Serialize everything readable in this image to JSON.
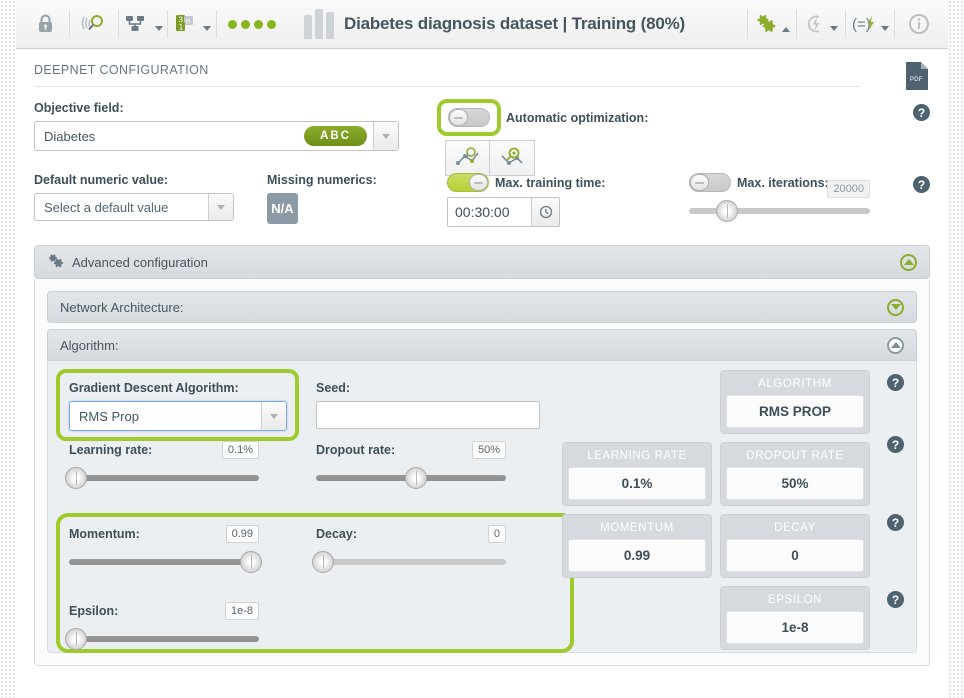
{
  "header": {
    "title": "Diabetes diagnosis dataset | Training (80%)",
    "icons": {
      "lock": "lock-icon",
      "source": "source-search-icon",
      "dataset": "dataset-tree-icon",
      "model": "model-badge-icon",
      "gear": "gear-icon",
      "flash": "flash-icon",
      "script": "script-icon",
      "info": "info-icon"
    }
  },
  "page": {
    "section_title": "DEEPNET CONFIGURATION",
    "pdf_label": "PDF"
  },
  "objective": {
    "label": "Objective field:",
    "value": "Diabetes",
    "badge": "ABC"
  },
  "automatic_optimization": {
    "label": "Automatic optimization:",
    "toggle_state": "off",
    "buttons": [
      "optimize-network-icon",
      "search-network-icon"
    ]
  },
  "default_numeric": {
    "label": "Default numeric value:",
    "placeholder": "Select a default value"
  },
  "missing_numerics": {
    "label": "Missing numerics:",
    "value": "N/A"
  },
  "max_training_time": {
    "label": "Max. training time:",
    "toggle_state": "on",
    "value": "00:30:00"
  },
  "max_iterations": {
    "label": "Max. iterations:",
    "toggle_state": "off",
    "value": "20000",
    "slider_percent": 20
  },
  "advanced": {
    "label": "Advanced configuration",
    "network_architecture": "Network Architecture:",
    "algorithm": "Algorithm:"
  },
  "algorithm_form": {
    "gradient_label": "Gradient Descent Algorithm:",
    "gradient_value": "RMS Prop",
    "seed_label": "Seed:",
    "seed_value": "",
    "learning_rate_label": "Learning rate:",
    "learning_rate_value": "0.1%",
    "learning_rate_percent": 2,
    "dropout_label": "Dropout rate:",
    "dropout_value": "50%",
    "dropout_percent": 50,
    "momentum_label": "Momentum:",
    "momentum_value": "0.99",
    "momentum_percent": 92,
    "decay_label": "Decay:",
    "decay_value": "0",
    "decay_percent": 1,
    "epsilon_label": "Epsilon:",
    "epsilon_value": "1e-8",
    "epsilon_percent": 2
  },
  "summary": {
    "algorithm": {
      "title": "ALGORITHM",
      "value": "RMS PROP"
    },
    "learning_rate": {
      "title": "LEARNING RATE",
      "value": "0.1%"
    },
    "dropout_rate": {
      "title": "DROPOUT RATE",
      "value": "50%"
    },
    "momentum": {
      "title": "MOMENTUM",
      "value": "0.99"
    },
    "decay": {
      "title": "DECAY",
      "value": "0"
    },
    "epsilon": {
      "title": "EPSILON",
      "value": "1e-8"
    }
  },
  "help_icon": "?",
  "colors": {
    "accent_green": "#9ccb2b",
    "badge_green": "#7a9a24",
    "toggle_on": "#b6cf34",
    "text_dark": "#3f4f59",
    "panel_bg": "#eceff1"
  }
}
